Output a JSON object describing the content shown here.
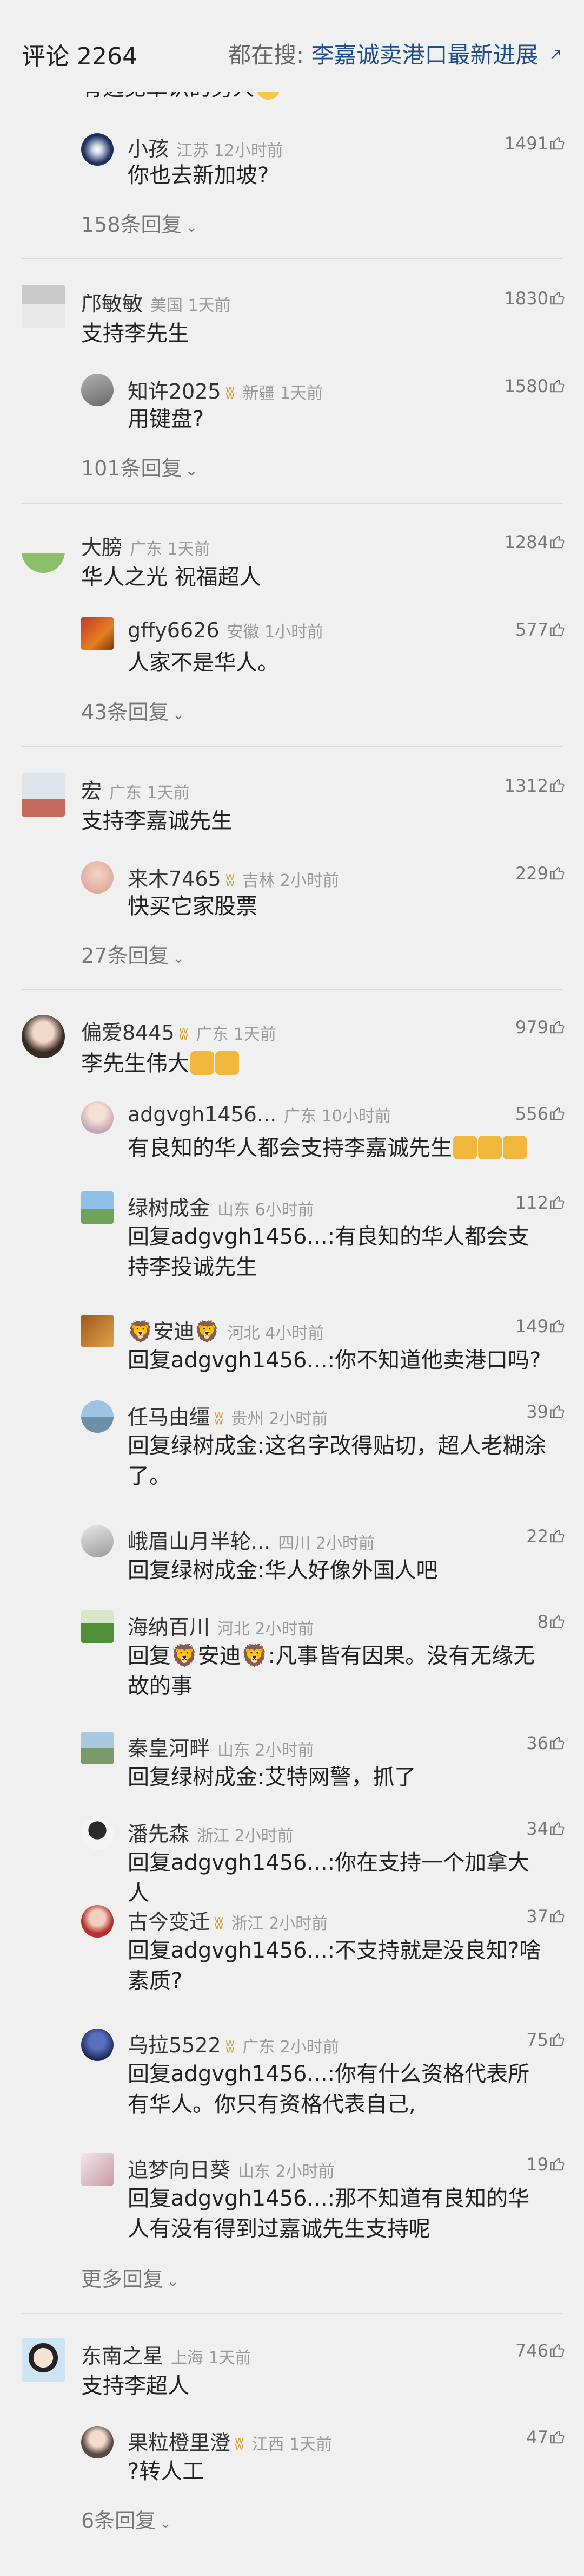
{
  "header": {
    "title": "评论 2264",
    "search_prefix": "都在搜:",
    "search_keyword": "李嘉诚卖港口最新进展",
    "search_arrow": "↗"
  },
  "partial_top_text": "有远见卓识的男人",
  "threads": [
    {
      "replies": [
        {
          "name": "小孩",
          "meta": "江苏 12小时前",
          "likes": "1491",
          "text": "你也去新加坡?"
        }
      ],
      "more": "158条回复"
    },
    {
      "name": "邝敏敏",
      "meta": "美国 1天前",
      "likes": "1830",
      "text": "支持李先生",
      "replies": [
        {
          "name": "知许2025",
          "meta": "新疆 1天前",
          "likes": "1580",
          "text": "用键盘?"
        }
      ],
      "more": "101条回复"
    },
    {
      "name": "大膀",
      "meta": "广东 1天前",
      "likes": "1284",
      "text": "华人之光 祝福超人",
      "replies": [
        {
          "name": "gffy6626",
          "meta": "安徽 1小时前",
          "likes": "577",
          "text": "人家不是华人。"
        }
      ],
      "more": "43条回复"
    },
    {
      "name": "宏",
      "meta": "广东 1天前",
      "likes": "1312",
      "text": "支持李嘉诚先生",
      "replies": [
        {
          "name": "来木7465",
          "meta": "吉林 2小时前",
          "likes": "229",
          "text": "快买它家股票"
        }
      ],
      "more": "27条回复"
    },
    {
      "name": "偏爱8445",
      "meta": "广东 1天前",
      "likes": "979",
      "text": "李先生伟大",
      "replies": [
        {
          "name": "adgvgh1456...",
          "meta": "广东 10小时前",
          "likes": "556",
          "text": "有良知的华人都会支持李嘉诚先生"
        },
        {
          "name": "绿树成金",
          "meta": "山东 6小时前",
          "likes": "112",
          "text": "回复adgvgh1456...:有良知的华人都会支持李投诚先生"
        },
        {
          "name": "🦁安迪🦁",
          "meta": "河北 4小时前",
          "likes": "149",
          "text": "回复adgvgh1456...:你不知道他卖港口吗?"
        },
        {
          "name": "任马由缰",
          "meta": "贵州 2小时前",
          "likes": "39",
          "text": "回复绿树成金:这名字改得贴切，超人老糊涂了。"
        },
        {
          "name": "峨眉山月半轮...",
          "meta": "四川 2小时前",
          "likes": "22",
          "text": "回复绿树成金:华人好像外国人吧"
        },
        {
          "name": "海纳百川",
          "meta": "河北 2小时前",
          "likes": "8",
          "text": "回复🦁安迪🦁:凡事皆有因果。没有无缘无故的事"
        },
        {
          "name": "秦皇河畔",
          "meta": "山东 2小时前",
          "likes": "36",
          "text": "回复绿树成金:艾特网警，抓了"
        },
        {
          "name": "潘先森",
          "meta": "浙江 2小时前",
          "likes": "34",
          "text": "回复adgvgh1456...:你在支持一个加拿大人"
        },
        {
          "name": "古今变迁",
          "meta": "浙江 2小时前",
          "likes": "37",
          "text": "回复adgvgh1456...:不支持就是没良知?啥素质?"
        },
        {
          "name": "乌拉5522",
          "meta": "广东 2小时前",
          "likes": "75",
          "text": "回复adgvgh1456...:你有什么资格代表所有华人。你只有资格代表自己,"
        },
        {
          "name": "追梦向日葵",
          "meta": "山东 2小时前",
          "likes": "19",
          "text": "回复adgvgh1456...:那不知道有良知的华人有没有得到过嘉诚先生支持呢"
        }
      ],
      "more": "更多回复"
    },
    {
      "name": "东南之星",
      "meta": "上海 1天前",
      "likes": "746",
      "text": "支持李超人",
      "replies": [
        {
          "name": "果粒橙里澄",
          "meta": "江西 1天前",
          "likes": "47",
          "text": "?转人工"
        }
      ],
      "more": "6条回复"
    }
  ],
  "colors": {
    "background": "#f0f0f0",
    "link": "#1f4f8a",
    "meta": "#9a9a9a",
    "vip": "#d6a030"
  }
}
